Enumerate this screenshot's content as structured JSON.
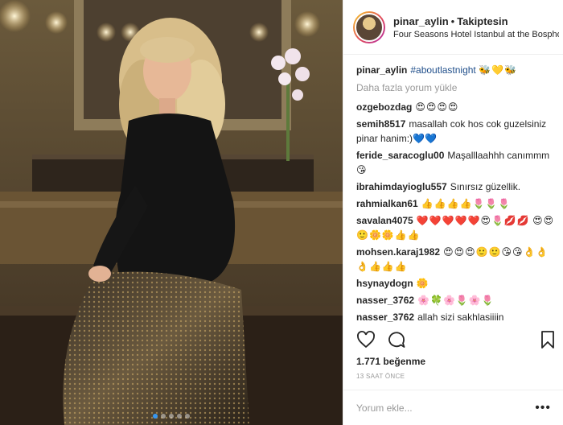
{
  "photo": {
    "slides": 5,
    "active_slide": 1
  },
  "header": {
    "username": "pinar_aylin",
    "separator": "•",
    "follow_status": "Takiptesin",
    "location": "Four Seasons Hotel Istanbul at the Bosphorus"
  },
  "caption": {
    "username": "pinar_aylin",
    "hashtag": "#aboutlastnight",
    "emojis": "🐝💛🐝"
  },
  "load_more": "Daha fazla yorum yükle",
  "comments": [
    {
      "user": "ozgebozdag",
      "text": "😍😍😍😍"
    },
    {
      "user": "semih8517",
      "text": "masallah cok hos cok guzelsiniz pinar hanim:)💙💙"
    },
    {
      "user": "feride_saracoglu00",
      "text": "Maşalllaahhh canımmm 😘"
    },
    {
      "user": "ibrahimdayioglu557",
      "text": "Sınırsız güzellik."
    },
    {
      "user": "rahmialkan61",
      "text": "👍👍👍👍🌷🌷🌷"
    },
    {
      "user": "savalan4075",
      "text": "❤️❤️❤️❤️❤️😍🌷💋💋"
    },
    {
      "user": "",
      "text": "😍😍🙂🌼🌼👍👍"
    },
    {
      "user": "mohsen.karaj1982",
      "text": "😍😍😍🙂🙂😘😘👌👌👌👍👍👍"
    },
    {
      "user": "hsynaydogn",
      "text": "🌼"
    },
    {
      "user": "nasser_3762",
      "text": "🌸🍀🌸🌷🌸🌷"
    },
    {
      "user": "nasser_3762",
      "text": "allah sizi sakhlasiiiin"
    }
  ],
  "likes": "1.771 beğenme",
  "timestamp": "13 SAAT ÖNCE",
  "comment_placeholder": "Yorum ekle...",
  "more_label": "•••",
  "colors": {
    "link": "#1f4e8a",
    "muted": "#999999",
    "accent": "#3897f0",
    "like_red": "#ed4956"
  },
  "icons": [
    "heart-icon",
    "comment-icon",
    "share-icon",
    "bookmark-icon"
  ]
}
